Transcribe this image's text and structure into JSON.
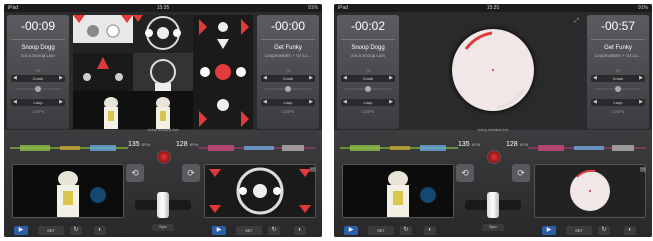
{
  "left": {
    "status": {
      "carrier": "iPad",
      "time": "15:35",
      "battery": "91%"
    },
    "deck_a": {
      "time": "-00:09",
      "track": "Snoop Dogg",
      "artist": "a.k.a Snoop Lion",
      "loop_label": "Loop",
      "trim_label": "Crush",
      "fx_caption": "FX",
      "cue_caption": "LOOPS"
    },
    "deck_b": {
      "time": "-00:00",
      "track": "Get Funky",
      "artist": "Loopmasters + VJ Lo...",
      "loop_label": "Loop",
      "trim_label": "Crush",
      "fx_caption": "FX",
      "cue_caption": "LOOPS"
    },
    "mixer": {
      "logo": "vidnp.mixlabs.live",
      "bpm_a": "135",
      "bpm_b": "128",
      "bpm_unit": "BPM",
      "set_label": "SET",
      "small_label": "Sync",
      "play_icon": "play-icon"
    }
  },
  "right": {
    "status": {
      "carrier": "iPad",
      "time": "15:35",
      "battery": "91%"
    },
    "deck_a": {
      "time": "-00:02",
      "track": "Snoop Dogg",
      "artist": "a.k.a Snoop Lion",
      "loop_label": "Loop",
      "trim_label": "Crush",
      "fx_caption": "FX",
      "cue_caption": "LOOPS"
    },
    "deck_b": {
      "time": "-00:57",
      "track": "Get Funky",
      "artist": "Loopmasters + VJ Lo...",
      "loop_label": "Loop",
      "trim_label": "Crush",
      "fx_caption": "FX",
      "cue_caption": "LOOPS"
    },
    "mixer": {
      "logo": "vidnp.mixlabs.live",
      "bpm_a": "135",
      "bpm_b": "128",
      "bpm_unit": "BPM",
      "set_label": "SET",
      "small_label": "Sync",
      "play_icon": "play-icon"
    }
  },
  "colors": {
    "accent": "#e03a3a",
    "play": "#2b5fa6",
    "panel": "#3c3c40"
  }
}
